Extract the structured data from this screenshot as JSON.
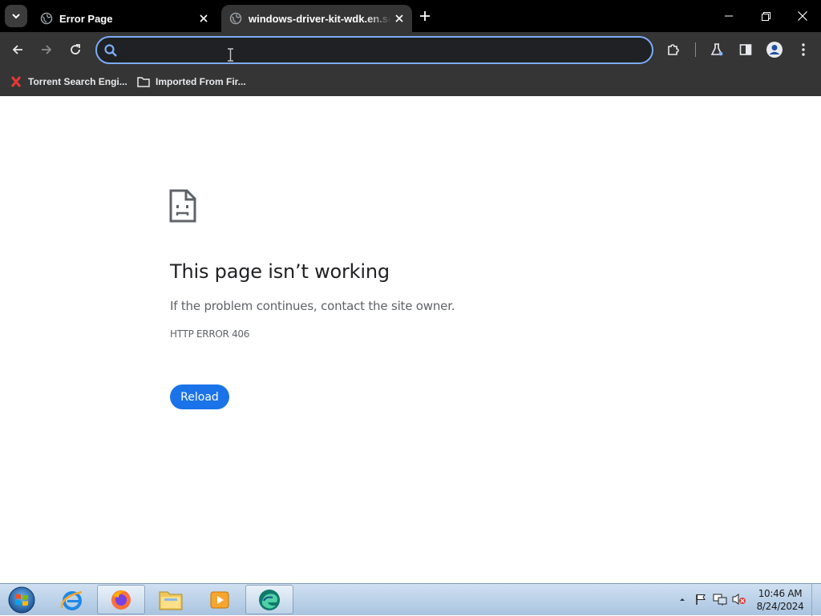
{
  "browser": {
    "tabs": [
      {
        "title": "Error Page",
        "favicon": "globe-icon"
      },
      {
        "title": "windows-driver-kit-wdk.en.softonic.com",
        "favicon": "globe-icon"
      }
    ],
    "omnibox": {
      "value": "",
      "placeholder": ""
    },
    "bookmarks": [
      {
        "label": "Torrent Search Engi...",
        "icon": "red-x-icon"
      },
      {
        "label": "Imported From Fir...",
        "icon": "folder-icon"
      }
    ]
  },
  "page": {
    "title": "This page isn’t working",
    "description": "If the problem continues, contact the site owner.",
    "error_code": "HTTP ERROR 406",
    "reload_label": "Reload"
  },
  "taskbar": {
    "apps": [
      "internet-explorer",
      "firefox",
      "file-explorer",
      "media-player",
      "edge"
    ],
    "clock_time": "10:46 AM",
    "clock_date": "8/24/2024"
  },
  "colors": {
    "accent": "#1a73e8",
    "omnibox_focus": "#7cacf8",
    "toolbar": "#353535",
    "titlebar": "#000000"
  }
}
